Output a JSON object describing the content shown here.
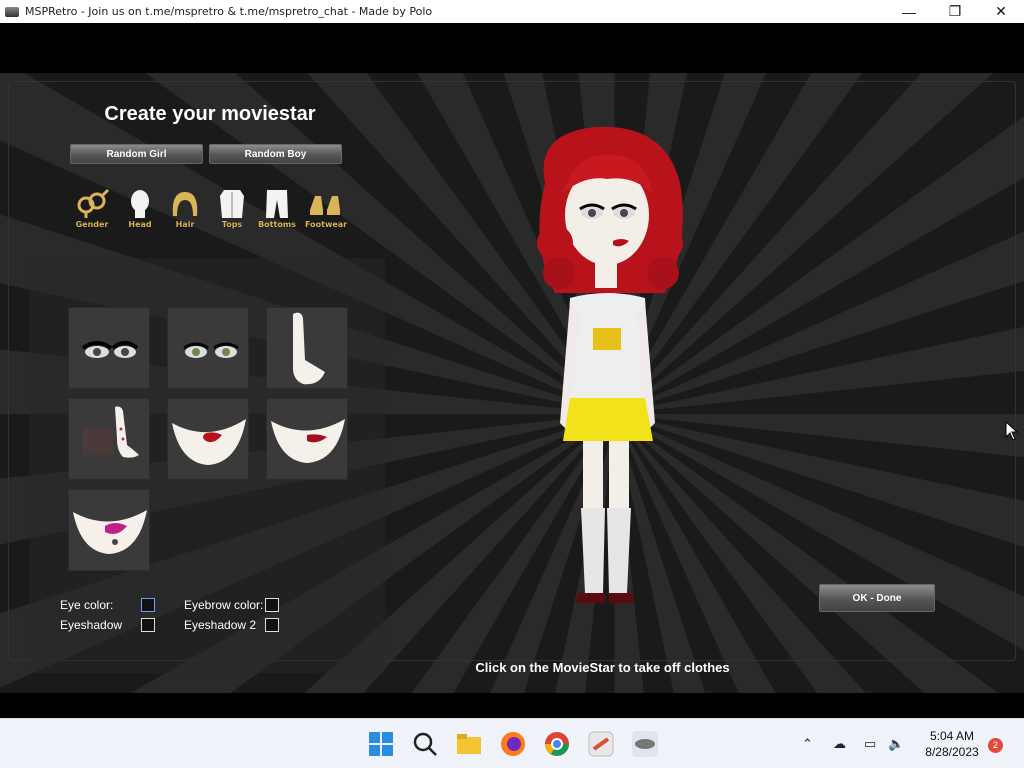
{
  "window": {
    "title": "MSPRetro - Join us on t.me/mspretro & t.me/mspretro_chat - Made by Polo",
    "minimize": "—",
    "maximize": "❐",
    "close": "✕"
  },
  "editor": {
    "heading": "Create your moviestar",
    "random_girl": "Random Girl",
    "random_boy": "Random Boy",
    "categories": [
      {
        "label": "Gender",
        "icon": "gender-icon"
      },
      {
        "label": "Head",
        "icon": "head-icon"
      },
      {
        "label": "Hair",
        "icon": "hair-icon"
      },
      {
        "label": "Tops",
        "icon": "tops-icon"
      },
      {
        "label": "Bottoms",
        "icon": "bottoms-icon"
      },
      {
        "label": "Footwear",
        "icon": "footwear-icon"
      }
    ],
    "colors": {
      "eye_color": "Eye color:",
      "eyebrow_color": "Eyebrow color:",
      "eyeshadow": "Eyeshadow",
      "eyeshadow2": "Eyeshadow 2"
    },
    "ok_done": "OK - Done",
    "hint": "Click on the MovieStar to take off clothes"
  },
  "taskbar": {
    "time": "5:04 AM",
    "date": "8/28/2023",
    "notifications": "2"
  },
  "colors": {
    "accent_gold": "#d9b45a",
    "hair_red": "#c0151a",
    "skirt_yellow": "#f2e21a"
  }
}
